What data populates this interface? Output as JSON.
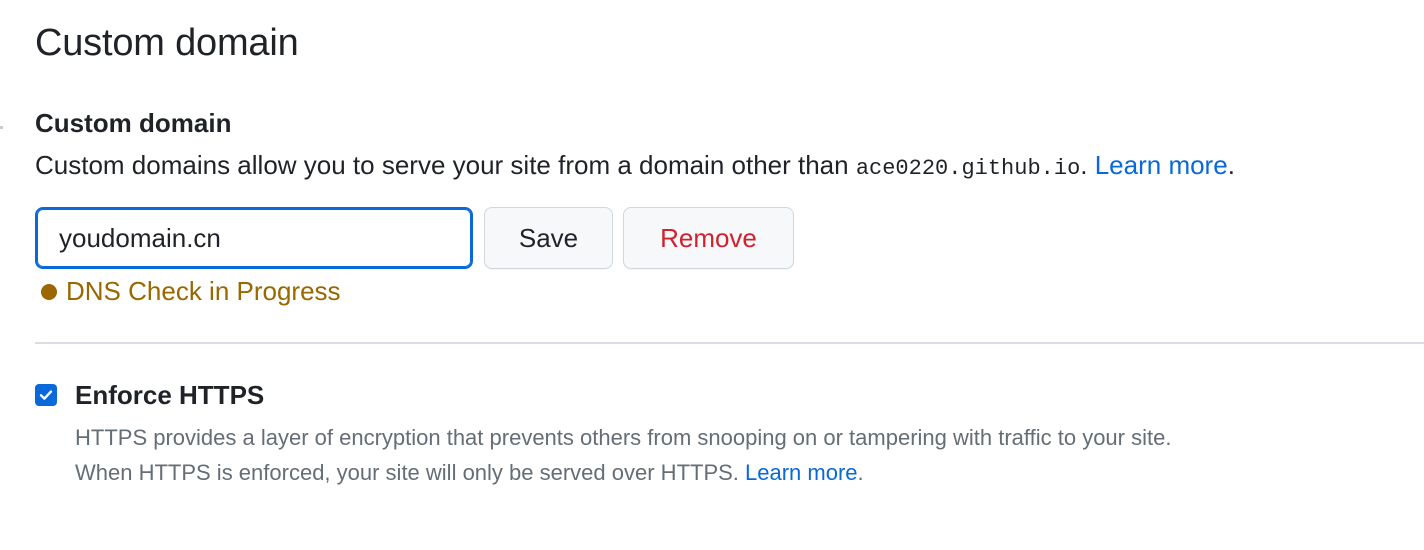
{
  "page": {
    "title": "Custom domain"
  },
  "custom_domain": {
    "label": "Custom domain",
    "description_prefix": "Custom domains allow you to serve your site from a domain other than ",
    "default_domain": "ace0220.github.io",
    "description_suffix": ". ",
    "learn_more": "Learn more",
    "trailing_period": ".",
    "input_value": "youdomain.cn",
    "save_label": "Save",
    "remove_label": "Remove",
    "dns_status": "DNS Check in Progress"
  },
  "enforce_https": {
    "label": "Enforce HTTPS",
    "checked": true,
    "description_line1": "HTTPS provides a layer of encryption that prevents others from snooping on or tampering with traffic to your site.",
    "description_line2_prefix": "When HTTPS is enforced, your site will only be served over HTTPS. ",
    "learn_more": "Learn more",
    "trailing_period": "."
  },
  "colors": {
    "accent": "#0969da",
    "danger": "#cf222e",
    "attention": "#9a6700",
    "muted": "#656d76"
  },
  "icons": {
    "checkbox": "check-icon",
    "status": "status-dot-icon"
  }
}
